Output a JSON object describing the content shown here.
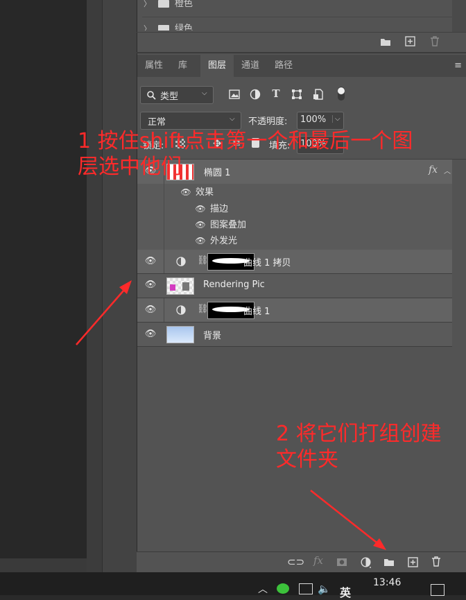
{
  "swatches": {
    "folders": [
      "橙色",
      "绿色"
    ]
  },
  "tabs": [
    "属性",
    "库",
    "图层",
    "通道",
    "路径"
  ],
  "active_tab": "图层",
  "filter": {
    "kind_label": "类型"
  },
  "blend": {
    "mode": "正常",
    "opacity_label": "不透明度:",
    "opacity_value": "100%"
  },
  "lock": {
    "lock_label": "锁定:",
    "fill_label": "填充:",
    "fill_value": "100%"
  },
  "layers": {
    "ellipse": {
      "name": "椭圆 1",
      "fx": "fx"
    },
    "effects": {
      "title": "效果",
      "items": [
        "描边",
        "图案叠加",
        "外发光"
      ]
    },
    "curves_copy": {
      "name": "曲线 1 拷贝"
    },
    "rendering": {
      "name": "Rendering Pic"
    },
    "curves": {
      "name": "曲线 1"
    },
    "background": {
      "name": "背景"
    }
  },
  "annotations": {
    "step1_line1": "1 按住shift点击第一个和最后一个图",
    "step1_line2": "层选中他们",
    "step2_line1": "2 将它们打组创建",
    "step2_line2": "文件夹",
    "color": "#ff2a2a"
  },
  "taskbar": {
    "time": "13:46",
    "ime": "英"
  },
  "icons": [
    "folder-icon",
    "new-layer-icon",
    "trash-icon",
    "search-icon",
    "image-filter-icon",
    "adjustment-filter-icon",
    "type-filter-icon",
    "shape-filter-icon",
    "smart-object-filter-icon",
    "filter-toggle-icon",
    "eye-icon",
    "chain-icon",
    "link-icon",
    "fx-icon",
    "mask-icon",
    "adjustment-icon",
    "wechat-icon",
    "volume-icon"
  ]
}
